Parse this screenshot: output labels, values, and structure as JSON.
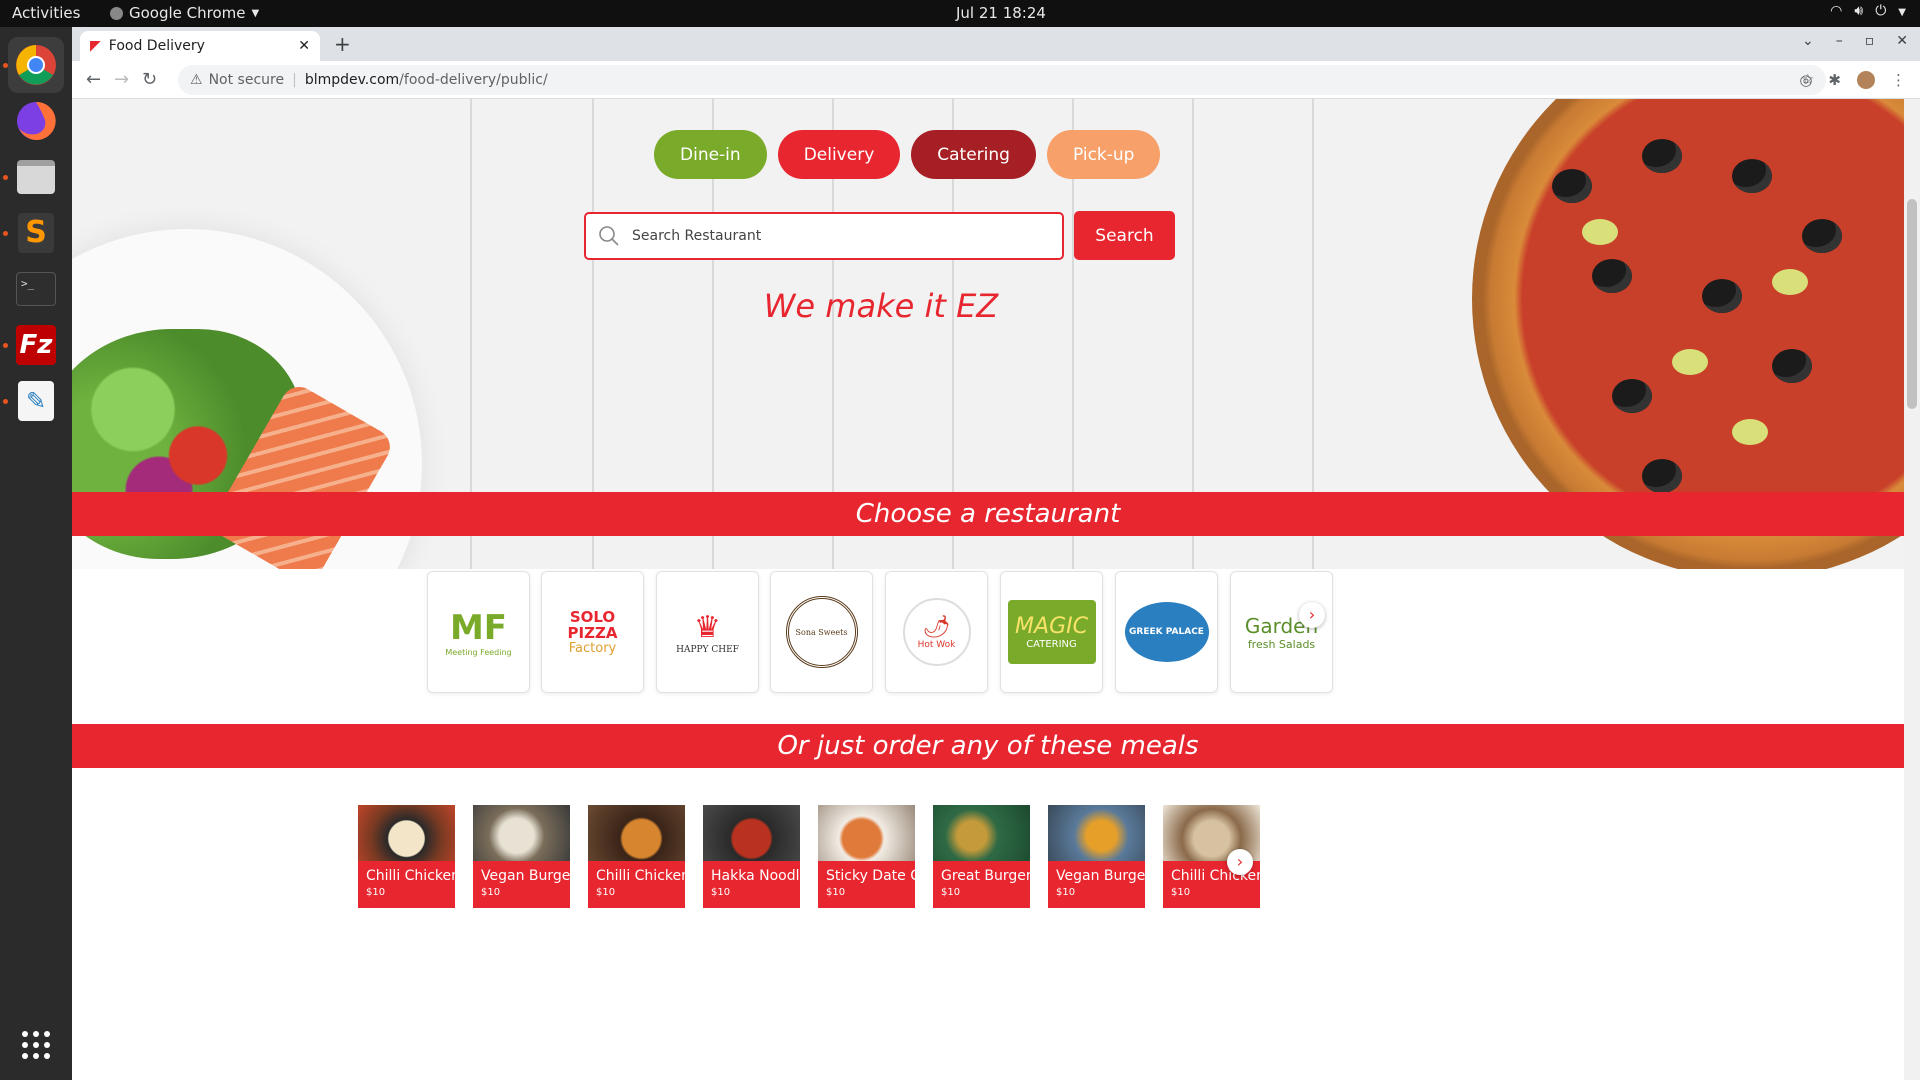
{
  "system_bar": {
    "activities": "Activities",
    "app_name": "Google Chrome",
    "clock": "Jul 21  18:24"
  },
  "dock": {
    "items": [
      "chrome-icon",
      "firefox-icon",
      "files-icon",
      "sublime-icon",
      "terminal-icon",
      "filezilla-icon",
      "text-editor-icon",
      "app-grid-icon"
    ]
  },
  "browser": {
    "tab_title": "Food Delivery",
    "url_warning": "Not secure",
    "url_host": "blmpdev.com",
    "url_path": "/food-delivery/public/"
  },
  "hero": {
    "services": [
      {
        "label": "Dine-in",
        "color": "#7aaa2a"
      },
      {
        "label": "Delivery",
        "color": "#e8262f"
      },
      {
        "label": "Catering",
        "color": "#a61f25"
      },
      {
        "label": "Pick-up",
        "color": "#f7a06a"
      }
    ],
    "search_placeholder": "Search Restaurant",
    "search_button": "Search",
    "tagline": "We make it EZ"
  },
  "restaurants_banner": "Choose a restaurant",
  "restaurants": [
    {
      "logo_text": "MF",
      "sub": "Meeting Feeding",
      "color": "#7aaa2a"
    },
    {
      "logo_text": "SOLO PIZZA",
      "sub": "Factory",
      "color": "#e8262f"
    },
    {
      "logo_text": "HAPPY CHEF",
      "sub": "",
      "color": "#e8262f"
    },
    {
      "logo_text": "Sona Sweets",
      "sub": "",
      "color": "#5a3b1a"
    },
    {
      "logo_text": "Hot Wok",
      "sub": "",
      "color": "#d8372a"
    },
    {
      "logo_text": "MAGIC",
      "sub": "CATERING",
      "color": "#7aaa2a"
    },
    {
      "logo_text": "GREEK PALACE",
      "sub": "",
      "color": "#2a7fc0"
    },
    {
      "logo_text": "Garden",
      "sub": "fresh Salads",
      "color": "#5a8f2a"
    }
  ],
  "meals_banner": "Or just order any of these meals",
  "meals": [
    {
      "name": "Chilli Chicken",
      "price": "$10"
    },
    {
      "name": "Vegan Burger",
      "price": "$10"
    },
    {
      "name": "Chilli Chicken",
      "price": "$10"
    },
    {
      "name": "Hakka Noodles",
      "price": "$10"
    },
    {
      "name": "Sticky Date Ca",
      "price": "$10"
    },
    {
      "name": "Great Burger",
      "price": "$10"
    },
    {
      "name": "Vegan Burger",
      "price": "$10"
    },
    {
      "name": "Chilli Chicken",
      "price": "$10"
    }
  ]
}
